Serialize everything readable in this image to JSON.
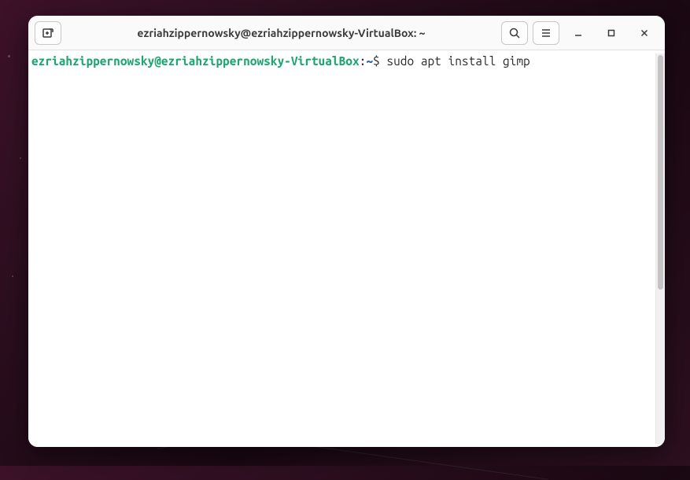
{
  "window": {
    "title": "ezriahzippernowsky@ezriahzippernowsky-VirtualBox: ~"
  },
  "terminal": {
    "prompt": {
      "user_host": "ezriahzippernowsky@ezriahzippernowsky-VirtualBox",
      "colon": ":",
      "path": "~",
      "symbol": "$ "
    },
    "command": "sudo apt install gimp"
  },
  "colors": {
    "prompt_userhost": "#1ea572",
    "prompt_path": "#3060b0",
    "text": "#2c2c2c",
    "window_bg": "#ffffff",
    "titlebar_bg": "#fafafa"
  }
}
